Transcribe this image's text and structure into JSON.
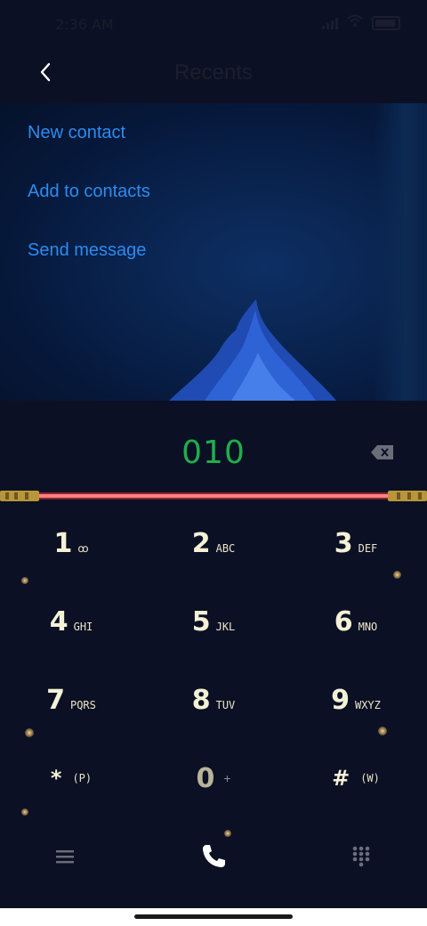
{
  "status": {
    "time": "2:36 AM"
  },
  "header": {
    "title": "Recents"
  },
  "actions": [
    "New contact",
    "Add to contacts",
    "Send message"
  ],
  "dialer": {
    "number": "010"
  },
  "keys": [
    {
      "digit": "1",
      "letters": "ꝏ"
    },
    {
      "digit": "2",
      "letters": "ABC"
    },
    {
      "digit": "3",
      "letters": "DEF"
    },
    {
      "digit": "4",
      "letters": "GHI"
    },
    {
      "digit": "5",
      "letters": "JKL"
    },
    {
      "digit": "6",
      "letters": "MNO"
    },
    {
      "digit": "7",
      "letters": "PQRS"
    },
    {
      "digit": "8",
      "letters": "TUV"
    },
    {
      "digit": "9",
      "letters": "WXYZ"
    },
    {
      "digit": "*",
      "letters": "(P)"
    },
    {
      "digit": "0",
      "letters": "+"
    },
    {
      "digit": "#",
      "letters": "(W)"
    }
  ],
  "colors": {
    "accent": "#2d8bf0",
    "number": "#1fae4b",
    "background": "#0c1024",
    "saber": "#e23a3a"
  },
  "icons": [
    "back-arrow-icon",
    "backspace-icon",
    "voicemail-icon",
    "menu-icon",
    "call-icon",
    "dialpad-icon",
    "wifi-icon",
    "signal-icon",
    "battery-icon"
  ]
}
